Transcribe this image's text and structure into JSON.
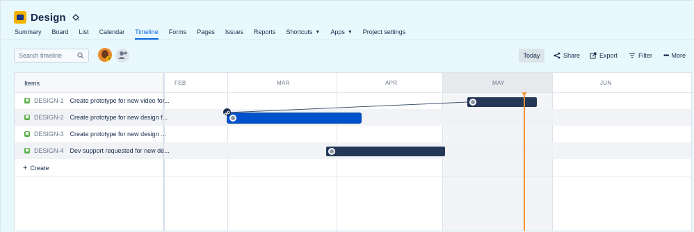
{
  "project": {
    "title": "Design",
    "paint_icon": "paint-bucket-icon"
  },
  "tabs": [
    {
      "label": "Summary",
      "active": false
    },
    {
      "label": "Board",
      "active": false
    },
    {
      "label": "List",
      "active": false
    },
    {
      "label": "Calendar",
      "active": false
    },
    {
      "label": "Timeline",
      "active": true
    },
    {
      "label": "Forms",
      "active": false
    },
    {
      "label": "Pages",
      "active": false
    },
    {
      "label": "Issues",
      "active": false
    },
    {
      "label": "Reports",
      "active": false
    },
    {
      "label": "Shortcuts",
      "active": false,
      "dropdown": true
    },
    {
      "label": "Apps",
      "active": false,
      "dropdown": true
    },
    {
      "label": "Project settings",
      "active": false
    }
  ],
  "toolbar": {
    "search_placeholder": "Search timeline",
    "today_label": "Today",
    "share_label": "Share",
    "export_label": "Export",
    "filter_label": "Filter",
    "more_label": "More",
    "avatar_badge": "V"
  },
  "timeline": {
    "items_header": "Items",
    "months": [
      "FEB",
      "MAR",
      "APR",
      "MAY",
      "JUN"
    ],
    "current_month": "MAY",
    "issues": [
      {
        "key": "DESIGN-1",
        "summary": "Create prototype for new video for...",
        "selected": false
      },
      {
        "key": "DESIGN-2",
        "summary": "Create prototype for new design f...",
        "selected": true
      },
      {
        "key": "DESIGN-3",
        "summary": "Create prototype for new design ...",
        "selected": false
      },
      {
        "key": "DESIGN-4",
        "summary": "Dev support requested for new de...",
        "selected": false
      }
    ],
    "create_label": "Create"
  },
  "colors": {
    "accent": "#0c66e4",
    "bar": "#253858",
    "bar_selected": "#0052cc",
    "today_line": "#f79232",
    "issue_icon": "#5ab14a",
    "page_bg": "#e8f8fc"
  }
}
